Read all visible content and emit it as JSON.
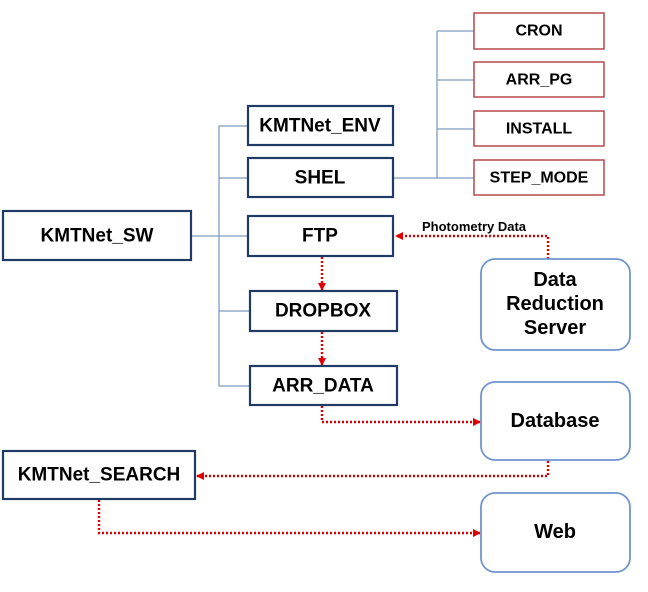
{
  "nodes": {
    "root": "KMTNet_SW",
    "env": "KMTNet_ENV",
    "shel": "SHEL",
    "ftp": "FTP",
    "dropbox": "DROPBOX",
    "arr_data": "ARR_DATA",
    "cron": "CRON",
    "arr_pg": "ARR_PG",
    "install": "INSTALL",
    "step_mode": "STEP_MODE",
    "drs_line1": "Data",
    "drs_line2": "Reduction",
    "drs_line3": "Server",
    "database": "Database",
    "search": "KMTNet_SEARCH",
    "web": "Web"
  },
  "edge_labels": {
    "photometry": "Photometry Data"
  },
  "colors": {
    "module_border": "#1f3b63",
    "shel_child_border": "#b5484a",
    "external_border": "#6f95cf",
    "tree_line": "#7f9cc2",
    "data_flow": "#e00000"
  }
}
